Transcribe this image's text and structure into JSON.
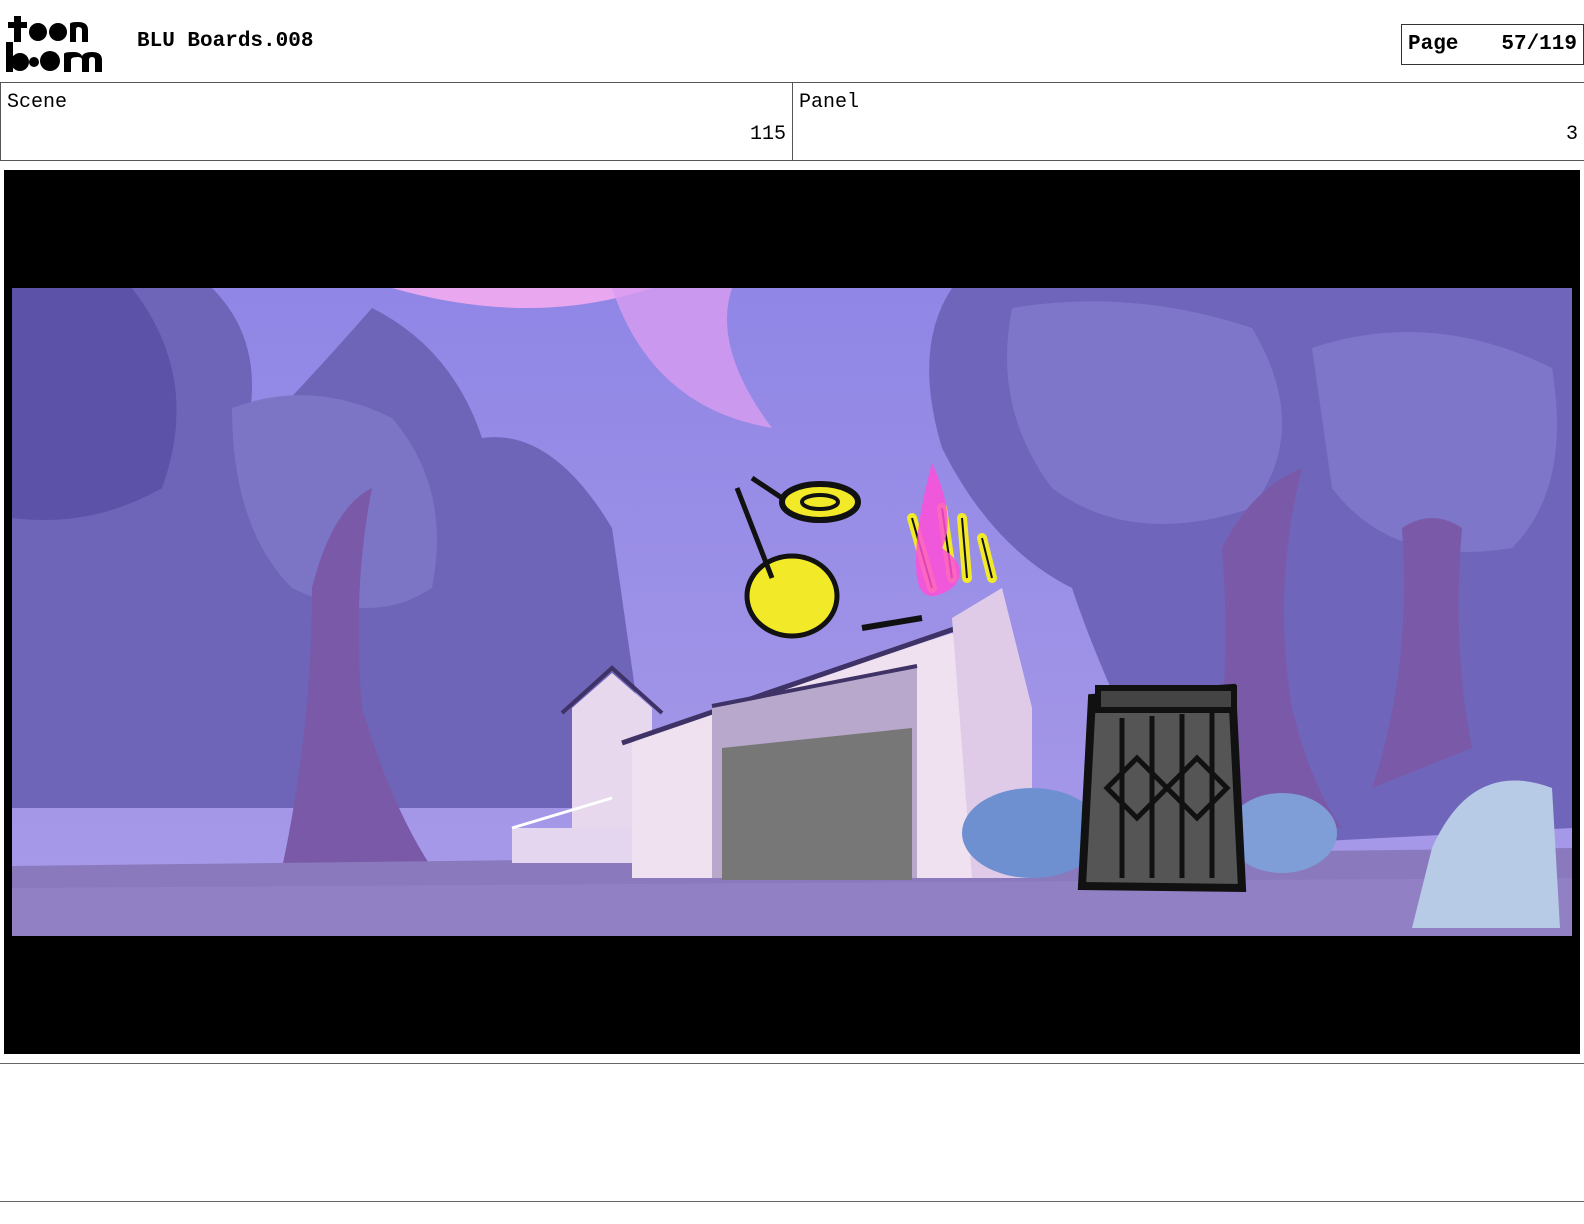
{
  "header": {
    "logo": {
      "line1": "toon",
      "line2": "boom",
      "icon": "toon-boom-logo"
    },
    "title": "BLU Boards.008",
    "page": {
      "label": "Page",
      "value": "57/119"
    }
  },
  "scene": {
    "label": "Scene",
    "value": "115"
  },
  "panel": {
    "label": "Panel",
    "value": "3"
  },
  "frame": {
    "illustration": "storyboard-panel-illustration"
  },
  "notes": {
    "text": ""
  }
}
